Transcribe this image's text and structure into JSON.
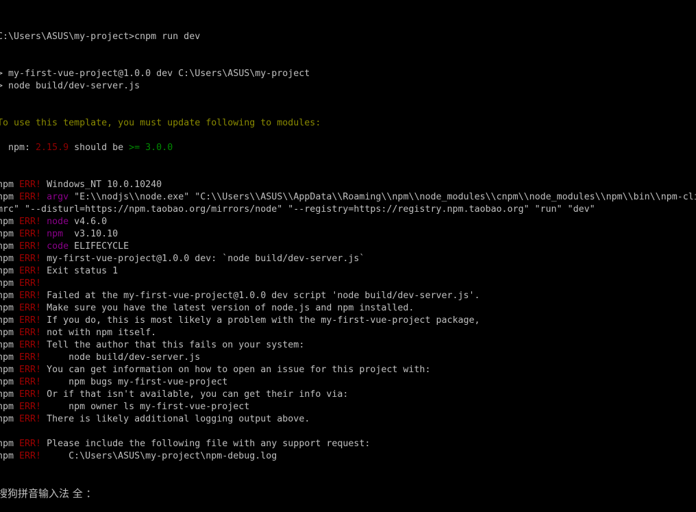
{
  "colors": {
    "fg": "#c0c0c0",
    "err": "#a00000",
    "magenta": "#8b008b",
    "yellow": "#8a8a00",
    "red": "#900000",
    "green": "#008a00",
    "background": "#000000"
  },
  "terminal": {
    "lines": [
      [
        {
          "t": "C:\\Users\\ASUS\\my-project>cnpm run dev"
        }
      ],
      [],
      [],
      [
        {
          "t": "> my-first-vue-project@1.0.0 dev C:\\Users\\ASUS\\my-project"
        }
      ],
      [
        {
          "t": "> node build/dev-server.js"
        }
      ],
      [],
      [],
      [
        {
          "t": "To use this template, you must update following to modules:",
          "c": "yellow"
        }
      ],
      [],
      [
        {
          "t": "  npm: "
        },
        {
          "t": "2.15.9",
          "c": "red"
        },
        {
          "t": " should be "
        },
        {
          "t": ">= 3.0.0",
          "c": "green"
        }
      ],
      [],
      [],
      [
        {
          "t": "npm "
        },
        {
          "t": "ERR!",
          "c": "err"
        },
        {
          "t": " Windows_NT 10.0.10240"
        }
      ],
      [
        {
          "t": "npm "
        },
        {
          "t": "ERR!",
          "c": "err"
        },
        {
          "t": " "
        },
        {
          "t": "argv",
          "c": "magenta"
        },
        {
          "t": " \"E:\\\\nodjs\\\\node.exe\" \"C:\\\\Users\\\\ASUS\\\\AppData\\\\Roaming\\\\npm\\\\node_modules\\\\cnpm\\\\node_modules\\\\npm\\\\bin\\\\npm-cli"
        }
      ],
      [
        {
          "t": "mrc\" \"--disturl=https://npm.taobao.org/mirrors/node\" \"--registry=https://registry.npm.taobao.org\" \"run\" \"dev\""
        }
      ],
      [
        {
          "t": "npm "
        },
        {
          "t": "ERR!",
          "c": "err"
        },
        {
          "t": " "
        },
        {
          "t": "node",
          "c": "magenta"
        },
        {
          "t": " v4.6.0"
        }
      ],
      [
        {
          "t": "npm "
        },
        {
          "t": "ERR!",
          "c": "err"
        },
        {
          "t": " "
        },
        {
          "t": "npm",
          "c": "magenta"
        },
        {
          "t": "  v3.10.10"
        }
      ],
      [
        {
          "t": "npm "
        },
        {
          "t": "ERR!",
          "c": "err"
        },
        {
          "t": " "
        },
        {
          "t": "code",
          "c": "magenta"
        },
        {
          "t": " ELIFECYCLE"
        }
      ],
      [
        {
          "t": "npm "
        },
        {
          "t": "ERR!",
          "c": "err"
        },
        {
          "t": " my-first-vue-project@1.0.0 dev: `node build/dev-server.js`"
        }
      ],
      [
        {
          "t": "npm "
        },
        {
          "t": "ERR!",
          "c": "err"
        },
        {
          "t": " Exit status 1"
        }
      ],
      [
        {
          "t": "npm "
        },
        {
          "t": "ERR!",
          "c": "err"
        }
      ],
      [
        {
          "t": "npm "
        },
        {
          "t": "ERR!",
          "c": "err"
        },
        {
          "t": " Failed at the my-first-vue-project@1.0.0 dev script 'node build/dev-server.js'."
        }
      ],
      [
        {
          "t": "npm "
        },
        {
          "t": "ERR!",
          "c": "err"
        },
        {
          "t": " Make sure you have the latest version of node.js and npm installed."
        }
      ],
      [
        {
          "t": "npm "
        },
        {
          "t": "ERR!",
          "c": "err"
        },
        {
          "t": " If you do, this is most likely a problem with the my-first-vue-project package,"
        }
      ],
      [
        {
          "t": "npm "
        },
        {
          "t": "ERR!",
          "c": "err"
        },
        {
          "t": " not with npm itself."
        }
      ],
      [
        {
          "t": "npm "
        },
        {
          "t": "ERR!",
          "c": "err"
        },
        {
          "t": " Tell the author that this fails on your system:"
        }
      ],
      [
        {
          "t": "npm "
        },
        {
          "t": "ERR!",
          "c": "err"
        },
        {
          "t": "     node build/dev-server.js"
        }
      ],
      [
        {
          "t": "npm "
        },
        {
          "t": "ERR!",
          "c": "err"
        },
        {
          "t": " You can get information on how to open an issue for this project with:"
        }
      ],
      [
        {
          "t": "npm "
        },
        {
          "t": "ERR!",
          "c": "err"
        },
        {
          "t": "     npm bugs my-first-vue-project"
        }
      ],
      [
        {
          "t": "npm "
        },
        {
          "t": "ERR!",
          "c": "err"
        },
        {
          "t": " Or if that isn't available, you can get their info via:"
        }
      ],
      [
        {
          "t": "npm "
        },
        {
          "t": "ERR!",
          "c": "err"
        },
        {
          "t": "     npm owner ls my-first-vue-project"
        }
      ],
      [
        {
          "t": "npm "
        },
        {
          "t": "ERR!",
          "c": "err"
        },
        {
          "t": " There is likely additional logging output above."
        }
      ],
      [],
      [
        {
          "t": "npm "
        },
        {
          "t": "ERR!",
          "c": "err"
        },
        {
          "t": " Please include the following file with any support request:"
        }
      ],
      [
        {
          "t": "npm "
        },
        {
          "t": "ERR!",
          "c": "err"
        },
        {
          "t": "     C:\\Users\\ASUS\\my-project\\npm-debug.log"
        }
      ]
    ],
    "ime_status": "搜狗拼音输入法 全 ："
  }
}
